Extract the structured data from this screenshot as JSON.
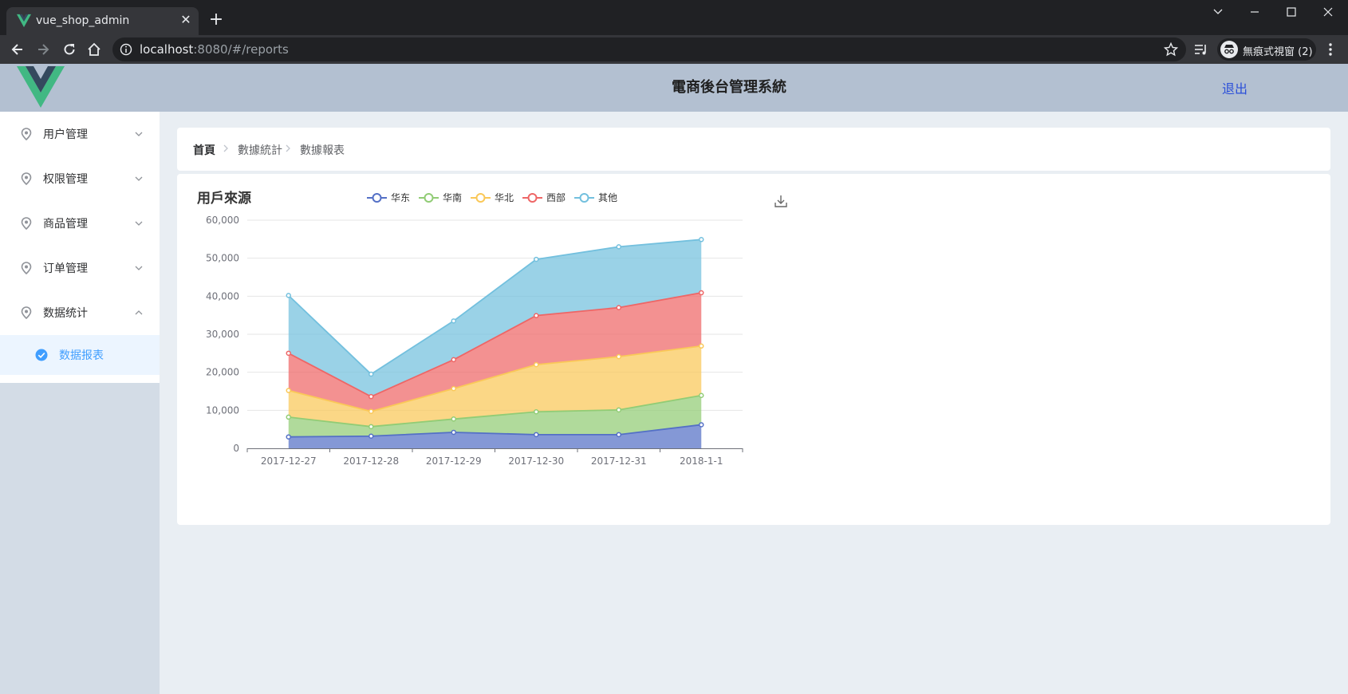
{
  "browser": {
    "tab_title": "vue_shop_admin",
    "url_host": "localhost",
    "url_rest": ":8080/#/reports",
    "incognito_label": "無痕式視窗 (2)"
  },
  "app": {
    "title": "電商後台管理系統",
    "logout_label": "退出"
  },
  "sidebar": {
    "items": [
      {
        "label": "用户管理",
        "icon": "location-icon",
        "expanded": false
      },
      {
        "label": "权限管理",
        "icon": "location-icon",
        "expanded": false
      },
      {
        "label": "商品管理",
        "icon": "location-icon",
        "expanded": false
      },
      {
        "label": "订单管理",
        "icon": "location-icon",
        "expanded": false
      },
      {
        "label": "数据统计",
        "icon": "location-icon",
        "expanded": true
      }
    ],
    "subitem": {
      "label": "数据报表",
      "icon": "check-circle-icon",
      "active": true
    }
  },
  "breadcrumb": [
    "首頁",
    "數據統計",
    "數據報表"
  ],
  "colors": {
    "header": "#b3c0d1",
    "sidebar": "#d3dce6",
    "main": "#e9eef3",
    "accent": "#409eff"
  },
  "chart_data": {
    "type": "area",
    "stacked": true,
    "title": "用戶來源",
    "categories": [
      "2017-12-27",
      "2017-12-28",
      "2017-12-29",
      "2017-12-30",
      "2017-12-31",
      "2018-1-1"
    ],
    "ylim": [
      0,
      60000
    ],
    "yticks": [
      0,
      10000,
      20000,
      30000,
      40000,
      50000,
      60000
    ],
    "ytick_labels": [
      "0",
      "10,000",
      "20,000",
      "30,000",
      "40,000",
      "50,000",
      "60,000"
    ],
    "legend_position": "top",
    "grid": true,
    "series": [
      {
        "name": "华东",
        "color": "#5470c6",
        "values": [
          3000,
          3200,
          4200,
          3600,
          3600,
          6200
        ]
      },
      {
        "name": "华南",
        "color": "#91cc75",
        "values": [
          5200,
          2500,
          3500,
          6000,
          6500,
          7700
        ]
      },
      {
        "name": "华北",
        "color": "#fac858",
        "values": [
          7000,
          4000,
          8000,
          12400,
          14000,
          13000
        ]
      },
      {
        "name": "西部",
        "color": "#ee6666",
        "values": [
          9800,
          3900,
          7600,
          12900,
          12900,
          14000
        ]
      },
      {
        "name": "其他",
        "color": "#73c0de",
        "values": [
          15200,
          5900,
          10200,
          14800,
          16000,
          14000
        ]
      }
    ]
  }
}
